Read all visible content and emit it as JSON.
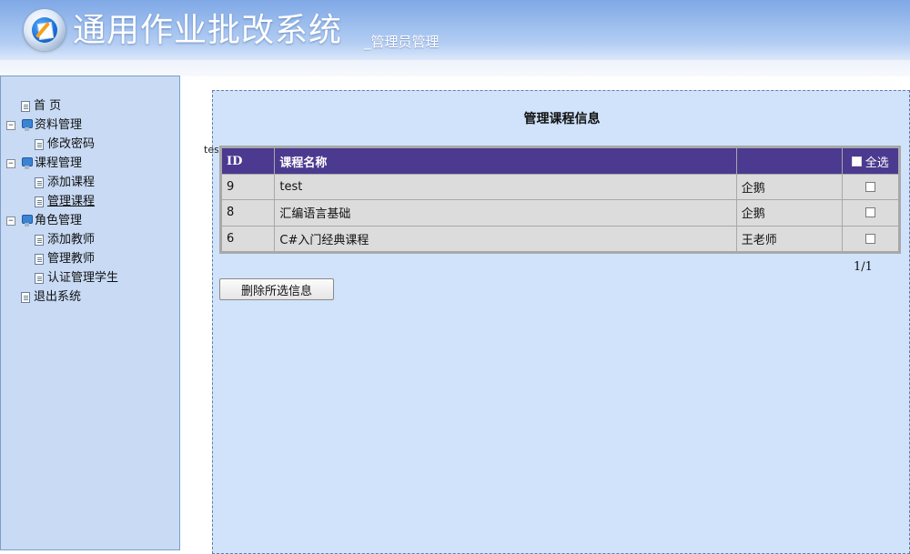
{
  "header": {
    "title": "通用作业批改系统",
    "subtitle": "_管理员管理",
    "logo_icon": "notepad-pencil-icon"
  },
  "sidebar": {
    "items": [
      {
        "label": "首 页",
        "icon": "page-icon"
      },
      {
        "label": "资料管理",
        "icon": "folder-icon",
        "toggle": "⊟"
      },
      {
        "label": "修改密码",
        "icon": "page-icon"
      },
      {
        "label": "课程管理",
        "icon": "folder-icon",
        "toggle": "⊟"
      },
      {
        "label": "添加课程",
        "icon": "page-icon"
      },
      {
        "label": "管理课程",
        "icon": "page-icon"
      },
      {
        "label": "角色管理",
        "icon": "folder-icon",
        "toggle": "⊟"
      },
      {
        "label": "添加教师",
        "icon": "page-icon"
      },
      {
        "label": "管理教师",
        "icon": "page-icon"
      },
      {
        "label": "认证管理学生",
        "icon": "page-icon"
      },
      {
        "label": "退出系统",
        "icon": "page-icon"
      }
    ]
  },
  "main": {
    "title": "管理课程信息",
    "stray_text": "test",
    "table": {
      "headers": {
        "id": "ID",
        "name": "课程名称",
        "teacher": "",
        "select_all": "全选"
      },
      "rows": [
        {
          "id": "9",
          "name": "test",
          "teacher": "企鹅"
        },
        {
          "id": "8",
          "name": "汇编语言基础",
          "teacher": "企鹅"
        },
        {
          "id": "6",
          "name": "C#入门经典课程",
          "teacher": "王老师"
        }
      ]
    },
    "pager": "1/1",
    "delete_button": "删除所选信息"
  },
  "colors": {
    "header_bg": "#7fa8e6",
    "sidebar_bg": "#c8daf4",
    "main_bg": "#d0e3fb",
    "table_header_bg": "#4b3a8f",
    "table_row_bg": "#dcdcdc"
  }
}
